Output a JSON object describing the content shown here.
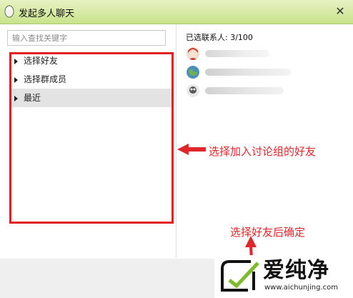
{
  "window": {
    "title": "发起多人聊天",
    "close_glyph": "✕"
  },
  "search": {
    "placeholder": "输入查找关键字"
  },
  "tree": {
    "items": [
      {
        "label": "选择好友",
        "selected": false
      },
      {
        "label": "选择群成员",
        "selected": false
      },
      {
        "label": "最近",
        "selected": true
      }
    ]
  },
  "right": {
    "selected_count": "已选联系人: 3/100",
    "contacts": [
      {
        "avatar": "red-avatar-icon",
        "color": "#d23b2a"
      },
      {
        "avatar": "earth-avatar-icon",
        "color": "#4a8fb8"
      },
      {
        "avatar": "gray-avatar-icon",
        "color": "#555555"
      }
    ]
  },
  "annotations": {
    "friends_callout": "选择加入讨论组的好友",
    "confirm_callout": "选择好友后确定",
    "color": "#e0262b"
  },
  "watermark": {
    "brand": "爱纯净",
    "url": "www.aichunjing.com"
  },
  "colors": {
    "titlebar_top": "#e6f2c2",
    "titlebar_bottom": "#c9e38c",
    "highlight_box": "#e02020",
    "selected_row": "#e3e3e3"
  }
}
